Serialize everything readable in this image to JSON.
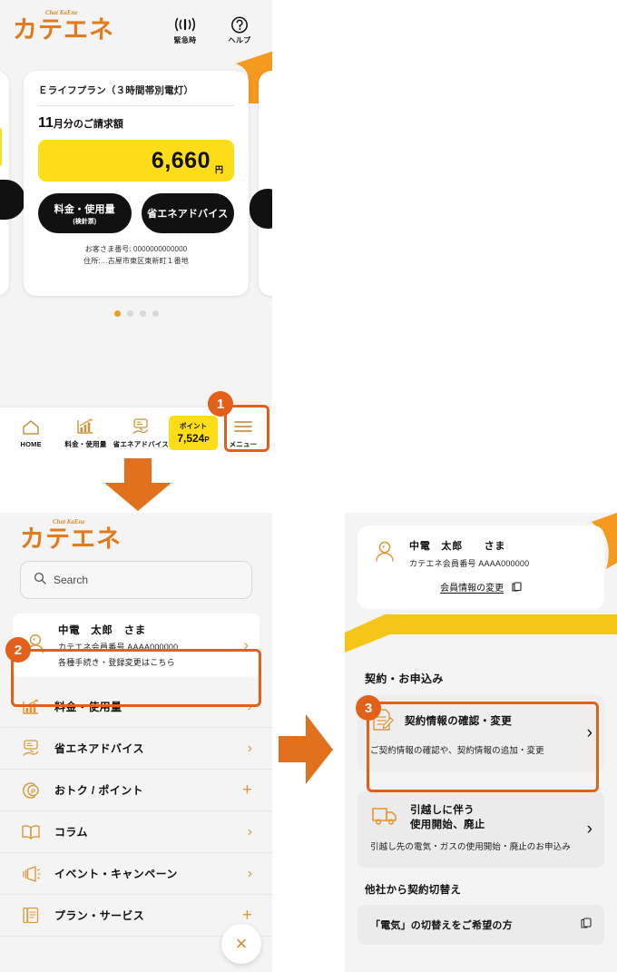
{
  "brand": {
    "logo_text": "カテエネ",
    "romaji": "Chat KaEne"
  },
  "panel_home": {
    "header_actions": [
      {
        "icon": "emergency-signal-icon",
        "label": "緊急時"
      },
      {
        "icon": "help-question-icon",
        "label": "ヘルプ"
      }
    ],
    "card": {
      "plan_title": "Ｅライフプラン（３時間帯別電灯）",
      "bill_month": "11",
      "bill_label_rest": "月分のご請求額",
      "amount": "6,660",
      "amount_unit": "円",
      "buttons": [
        {
          "line1": "料金・使用量",
          "line2": "(検針票)"
        },
        {
          "line1": "省エネアドバイス",
          "line2": ""
        }
      ],
      "customer_no": "お客さま番号: 0000000000000",
      "address": "住所:…古屋市東区東新町１番地"
    },
    "carousel_dots": 4,
    "carousel_active": 0,
    "tabbar": [
      {
        "icon": "home-icon",
        "label": "HOME"
      },
      {
        "icon": "bar-chart-icon",
        "label": "料金・使用量"
      },
      {
        "icon": "eco-advice-icon",
        "label": "省エネアドバイス"
      }
    ],
    "points": {
      "label": "ポイント",
      "value": "7,524",
      "unit": "P"
    },
    "menu_tab": {
      "icon": "hamburger-icon",
      "label": "メニュー"
    }
  },
  "steps": {
    "one": "1",
    "two": "2",
    "three": "3"
  },
  "panel_menu": {
    "search": {
      "placeholder": "Search",
      "icon": "search-icon"
    },
    "user": {
      "name": "中電　太郎　さま",
      "member_no": "カテエネ会員番号  AAAA000000",
      "sub": "各種手続き・登録変更はこちら",
      "icon": "user-avatar-icon",
      "chevron": "›"
    },
    "items": [
      {
        "icon": "bar-chart-icon",
        "label": "料金・使用量",
        "right": "›"
      },
      {
        "icon": "eco-advice-icon",
        "label": "省エネアドバイス",
        "right": "›"
      },
      {
        "icon": "point-circle-icon",
        "label": "おトク / ポイント",
        "right": "+"
      },
      {
        "icon": "book-icon",
        "label": "コラム",
        "right": "›"
      },
      {
        "icon": "megaphone-icon",
        "label": "イベント・キャンペーン",
        "right": "›"
      },
      {
        "icon": "document-icon",
        "label": "プラン・サービス",
        "right": "+"
      }
    ],
    "close_label": "×"
  },
  "panel_contract": {
    "user": {
      "name": "中電　太郎　　さま",
      "member_no": "カテエネ会員番号  AAAA000000",
      "change_link": "会員情報の変更",
      "change_icon": "external-link-icon",
      "icon": "user-avatar-icon"
    },
    "section_title": "契約・お申込み",
    "cards": [
      {
        "icon": "contract-doc-icon",
        "title": "契約情報の確認・変更",
        "desc": "ご契約情報の確認や、契約情報の追加・変更",
        "chevron": "›"
      },
      {
        "icon": "moving-truck-icon",
        "title": "引越しに伴う\n使用開始、廃止",
        "title_line1": "引越しに伴う",
        "title_line2": "使用開始、廃止",
        "desc": "引越し先の電気・ガスの使用開始・廃止のお申込み",
        "chevron": "›"
      }
    ],
    "sub_title": "他社から契約切替え",
    "bottom_card": {
      "title": "「電気」の切替えをご希望の方",
      "icon": "external-link-icon"
    }
  },
  "colors": {
    "brand_orange": "#e07b1e",
    "accent_orange": "#e2601a",
    "yellow": "#fcdd18",
    "deco_yellow": "#f5c518",
    "deco_orange": "#f59a1e"
  }
}
